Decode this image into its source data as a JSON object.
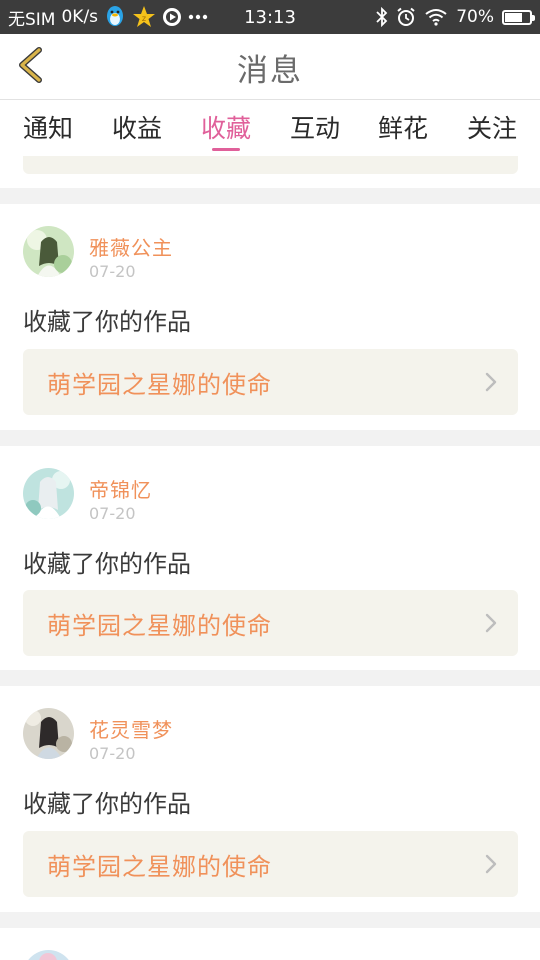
{
  "status_bar": {
    "carrier": "无SIM",
    "net_speed": "0K/s",
    "time": "13:13",
    "battery_text": "70%",
    "battery_level": 0.7,
    "icons": [
      "qq-penguin-icon",
      "qzone-star-icon",
      "media-play-icon",
      "more-dots-icon",
      "bluetooth-icon",
      "alarm-icon",
      "wifi-icon",
      "battery-icon"
    ]
  },
  "header": {
    "title": "消息",
    "back_icon": "chevron-left-icon"
  },
  "tabs": [
    {
      "label": "通知",
      "active": false
    },
    {
      "label": "收益",
      "active": false
    },
    {
      "label": "收藏",
      "active": true
    },
    {
      "label": "互动",
      "active": false
    },
    {
      "label": "鲜花",
      "active": false
    },
    {
      "label": "关注",
      "active": false
    }
  ],
  "messages": [
    {
      "user": "雅薇公主",
      "date": "07-20",
      "text": "收藏了你的作品",
      "work": "萌学园之星娜的使命"
    },
    {
      "user": "帝锦忆",
      "date": "07-20",
      "text": "收藏了你的作品",
      "work": "萌学园之星娜的使命"
    },
    {
      "user": "花灵雪梦",
      "date": "07-20",
      "text": "收藏了你的作品",
      "work": "萌学园之星娜的使命"
    }
  ],
  "colors": {
    "accent": "#e0609a",
    "username": "#f0915a",
    "work_bg": "#f4f3ec",
    "back_chevron": "#c9a23a",
    "statusbar_bg": "#3c3c3c"
  }
}
